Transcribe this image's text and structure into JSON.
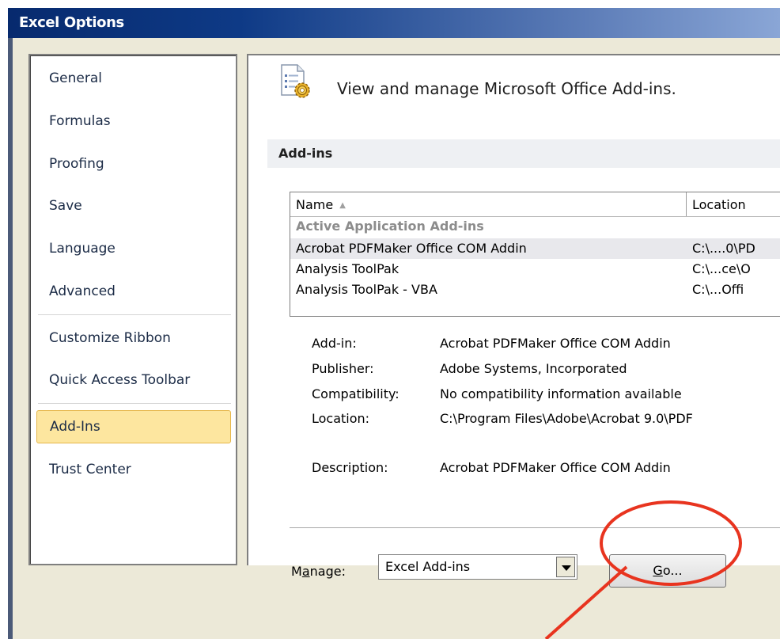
{
  "window": {
    "title": "Excel Options"
  },
  "sidebar": {
    "items": [
      {
        "label": "General"
      },
      {
        "label": "Formulas"
      },
      {
        "label": "Proofing"
      },
      {
        "label": "Save"
      },
      {
        "label": "Language"
      },
      {
        "label": "Advanced"
      },
      {
        "label": "Customize Ribbon"
      },
      {
        "label": "Quick Access Toolbar"
      },
      {
        "label": "Add-Ins",
        "selected": true
      },
      {
        "label": "Trust Center"
      }
    ]
  },
  "header": {
    "text": "View and manage Microsoft Office Add-ins.",
    "icon": "addins-gear-icon"
  },
  "section": {
    "title": "Add-ins"
  },
  "addins_table": {
    "columns": [
      "Name",
      "Location"
    ],
    "sort_indicator": "▲",
    "group": "Active Application Add-ins",
    "rows": [
      {
        "name": "Acrobat PDFMaker Office COM Addin",
        "location": "C:\\....0\\PD",
        "selected": true
      },
      {
        "name": "Analysis ToolPak",
        "location": "C:\\...ce\\O"
      },
      {
        "name": "Analysis ToolPak - VBA",
        "location": "C:\\...Offi"
      }
    ]
  },
  "details": [
    {
      "label": "Add-in:",
      "value": "Acrobat PDFMaker Office COM Addin"
    },
    {
      "label": "Publisher:",
      "value": "Adobe Systems, Incorporated"
    },
    {
      "label": "Compatibility:",
      "value": "No compatibility information available"
    },
    {
      "label": "Location:",
      "value": "C:\\Program Files\\Adobe\\Acrobat 9.0\\PDF"
    },
    {
      "label": "Description:",
      "value": "Acrobat PDFMaker Office COM Addin"
    }
  ],
  "manage": {
    "label_prefix": "M",
    "label_underlined": "a",
    "label_suffix": "nage:",
    "selected": "Excel Add-ins",
    "go_underlined": "G",
    "go_rest": "o..."
  },
  "annotation": {
    "color": "#e8341f"
  }
}
